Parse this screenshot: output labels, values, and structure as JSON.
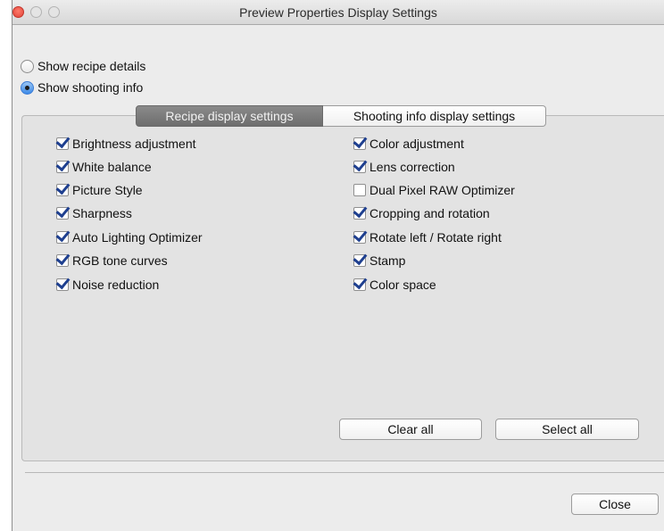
{
  "window": {
    "title": "Preview Properties Display Settings"
  },
  "display_mode": {
    "options": [
      {
        "label": "Show recipe details",
        "selected": false
      },
      {
        "label": "Show shooting info",
        "selected": true
      }
    ]
  },
  "tabs": [
    {
      "label": "Recipe display settings",
      "active": true
    },
    {
      "label": "Shooting info display settings",
      "active": false
    }
  ],
  "checkboxes": {
    "left": [
      {
        "label": "Brightness adjustment",
        "checked": true
      },
      {
        "label": "White balance",
        "checked": true
      },
      {
        "label": "Picture Style",
        "checked": true
      },
      {
        "label": "Sharpness",
        "checked": true
      },
      {
        "label": "Auto Lighting Optimizer",
        "checked": true
      },
      {
        "label": "RGB tone curves",
        "checked": true
      },
      {
        "label": "Noise reduction",
        "checked": true
      }
    ],
    "right": [
      {
        "label": "Color adjustment",
        "checked": true
      },
      {
        "label": "Lens correction",
        "checked": true
      },
      {
        "label": "Dual Pixel RAW Optimizer",
        "checked": false
      },
      {
        "label": "Cropping and rotation",
        "checked": true
      },
      {
        "label": "Rotate left / Rotate right",
        "checked": true
      },
      {
        "label": "Stamp",
        "checked": true
      },
      {
        "label": "Color space",
        "checked": true
      }
    ]
  },
  "buttons": {
    "clear_all": "Clear all",
    "select_all": "Select all",
    "close": "Close"
  }
}
